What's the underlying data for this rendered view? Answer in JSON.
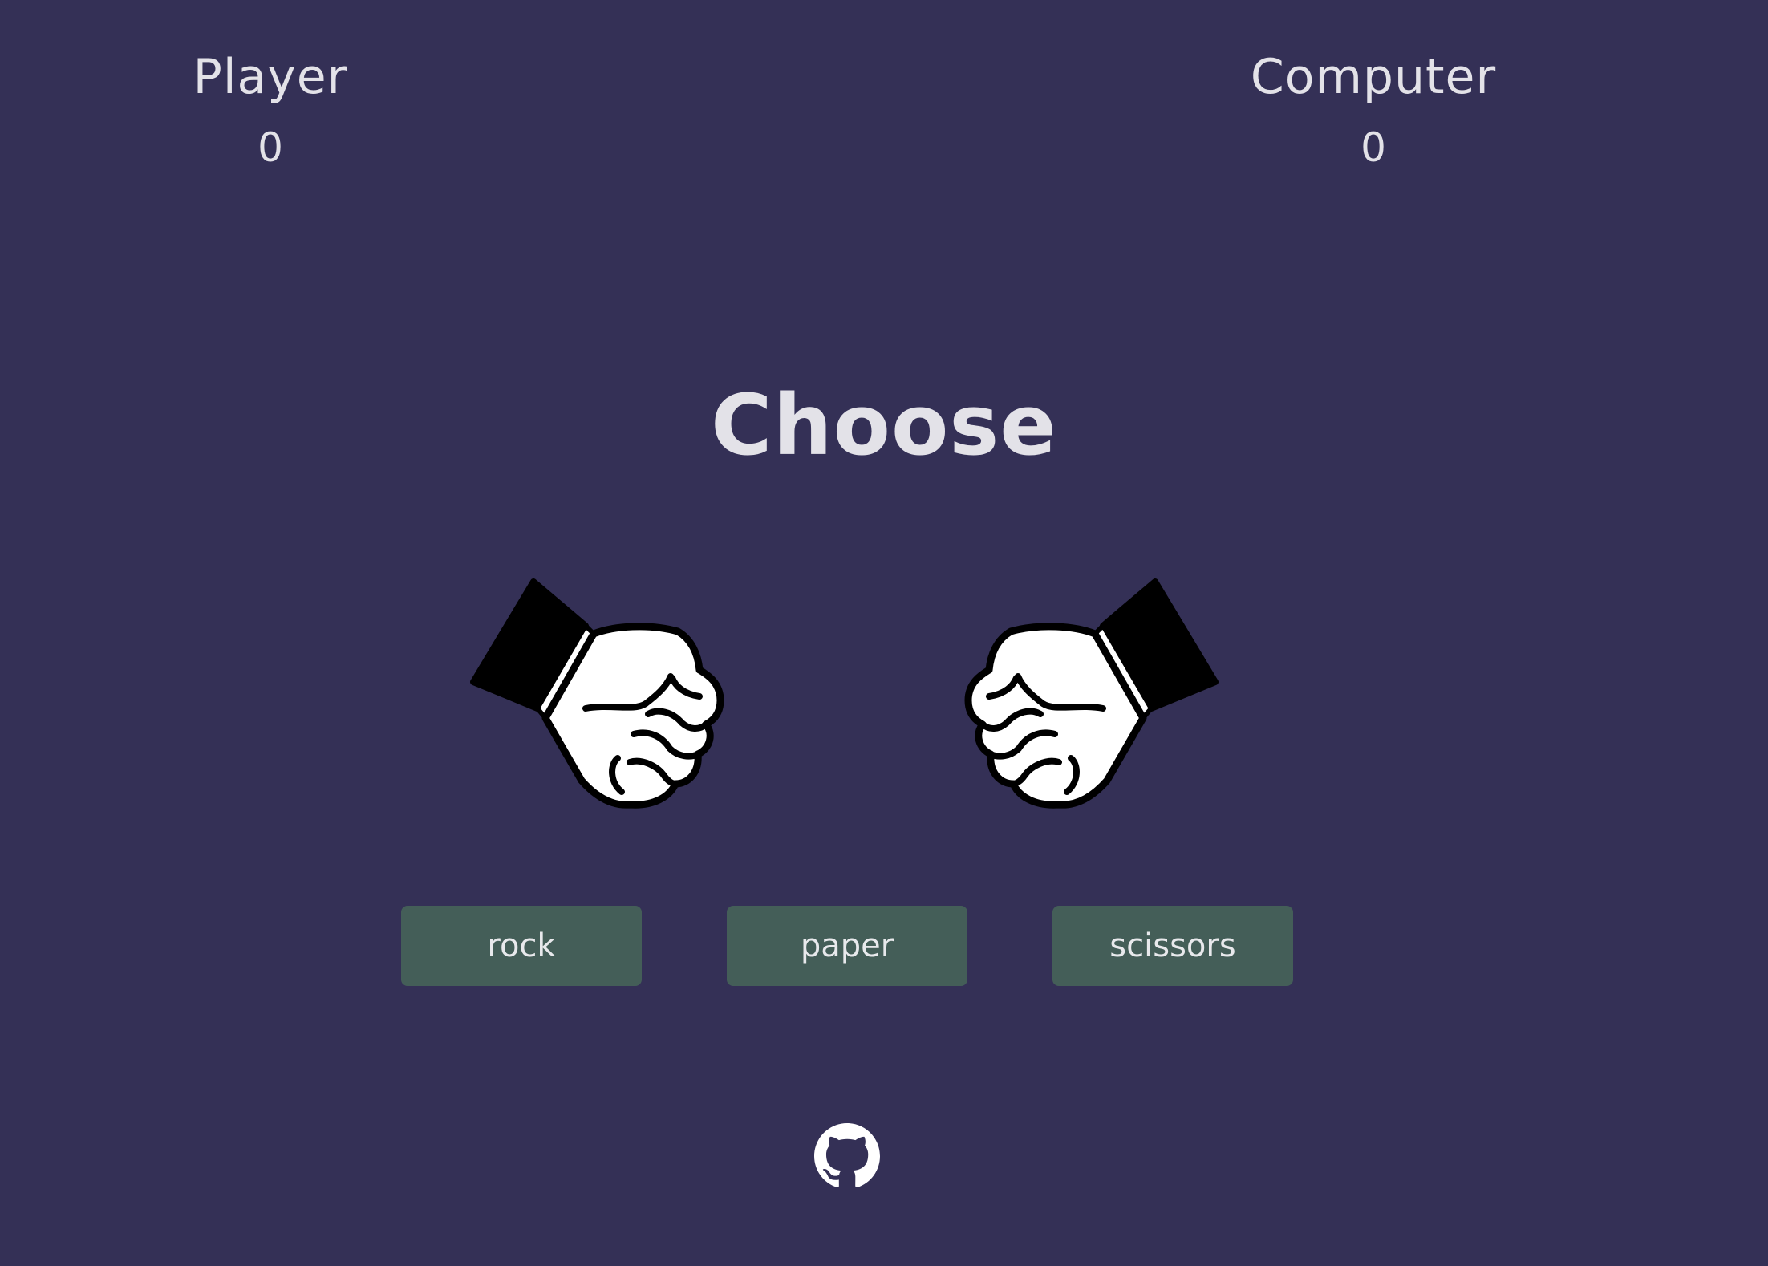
{
  "scoreboard": {
    "player": {
      "label": "Player",
      "score": "0"
    },
    "computer": {
      "label": "Computer",
      "score": "0"
    }
  },
  "prompt": "Choose",
  "hands": {
    "player": {
      "icon": "fist-icon",
      "shape": "rock"
    },
    "computer": {
      "icon": "fist-icon",
      "shape": "rock"
    }
  },
  "choices": [
    {
      "label": "rock"
    },
    {
      "label": "paper"
    },
    {
      "label": "scissors"
    }
  ],
  "footer": {
    "icon": "github-icon"
  },
  "colors": {
    "background": "#343056",
    "text": "#e3e2e8",
    "button": "#445e58"
  }
}
